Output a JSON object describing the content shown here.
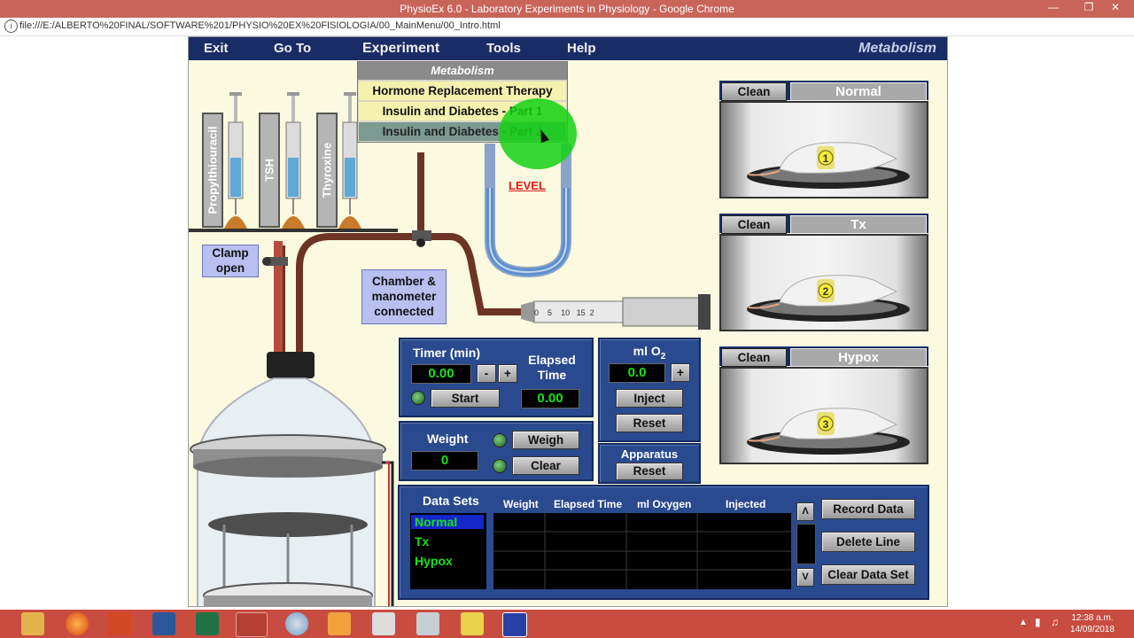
{
  "browser": {
    "window_title": "PhysioEx 6.0 - Laboratory Experiments in Physiology - Google Chrome",
    "url": "file:///E:/ALBERTO%20FINAL/SOFTWARE%201/PHYSIO%20EX%20FISIOLOGIA/00_MainMenu/00_Intro.html"
  },
  "menubar": {
    "items": [
      "Exit",
      "Go To",
      "Experiment",
      "Tools",
      "Help"
    ],
    "title": "Metabolism"
  },
  "dropdown": {
    "header": "Metabolism",
    "items": [
      "Hormone Replacement Therapy",
      "Insulin and Diabetes - Part 1",
      "Insulin and Diabetes - Part 2"
    ]
  },
  "shelf": {
    "labels": [
      "Propylthiouracil",
      "TSH",
      "Thyroxine"
    ]
  },
  "apparatus": {
    "clamp_label": "Clamp open",
    "chamber_label": "Chamber & manometer connected",
    "level_label": "LEVEL",
    "syringe_ticks": [
      "0",
      "5",
      "10",
      "15",
      "2"
    ]
  },
  "timer": {
    "label": "Timer (min)",
    "value": "0.00",
    "minus": "-",
    "plus": "+",
    "elapsed_label": "Elapsed Time",
    "elapsed_value": "0.00",
    "start": "Start"
  },
  "oxygen": {
    "label": "ml O",
    "sub": "2",
    "value": "0.0",
    "plus": "+",
    "inject": "Inject",
    "reset": "Reset"
  },
  "weight": {
    "label": "Weight",
    "value": "0",
    "weigh": "Weigh",
    "clear": "Clear"
  },
  "apparatus_panel": {
    "label": "Apparatus",
    "reset": "Reset"
  },
  "cages": [
    {
      "clean": "Clean",
      "name": "Normal",
      "number": "1"
    },
    {
      "clean": "Clean",
      "name": "Tx",
      "number": "2"
    },
    {
      "clean": "Clean",
      "name": "Hypox",
      "number": "3"
    }
  ],
  "datasets": {
    "label": "Data Sets",
    "items": [
      "Normal",
      "Tx",
      "Hypox"
    ],
    "columns": [
      "Weight",
      "Elapsed Time",
      "ml Oxygen",
      "Injected"
    ],
    "record": "Record Data",
    "delete": "Delete Line",
    "clear": "Clear Data Set",
    "up": "Λ",
    "down": "V"
  },
  "taskbar": {
    "time": "12:38 a.m.",
    "date": "14/09/2018"
  },
  "colors": {
    "titlebar": "#c96459",
    "menubar": "#1a2c66",
    "panel": "#2a4a8f",
    "lcd_text": "#19e019",
    "app_bg": "#fbf9e0"
  }
}
